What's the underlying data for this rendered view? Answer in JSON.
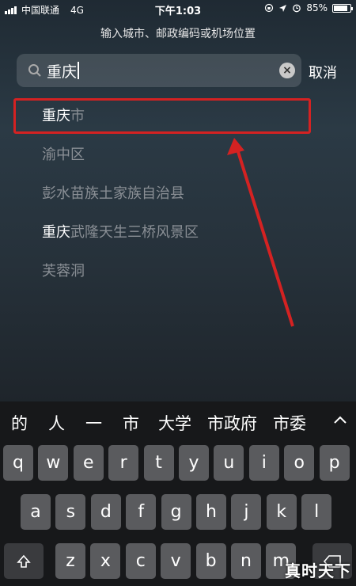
{
  "status_bar": {
    "carrier": "中国联通",
    "network": "4G",
    "time": "下午1:03",
    "battery": "85%",
    "battery_level": 0.85
  },
  "search": {
    "prompt": "输入城市、邮政编码或机场位置",
    "value": "重庆",
    "cancel_label": "取消"
  },
  "results": [
    {
      "match": "重庆",
      "rest": "市"
    },
    {
      "match": "",
      "rest": "渝中区"
    },
    {
      "match": "",
      "rest": "彭水苗族土家族自治县"
    },
    {
      "match": "重庆",
      "rest": "武隆天生三桥风景区"
    },
    {
      "match": "",
      "rest": "芙蓉洞"
    }
  ],
  "annotation_colors": {
    "box": "#d42222",
    "arrow": "#d42222"
  },
  "keyboard": {
    "candidates": [
      "的",
      "人",
      "一",
      "市",
      "大学",
      "市政府",
      "市委"
    ],
    "row1": [
      "q",
      "w",
      "e",
      "r",
      "t",
      "y",
      "u",
      "i",
      "o",
      "p"
    ],
    "row2": [
      "a",
      "s",
      "d",
      "f",
      "g",
      "h",
      "j",
      "k",
      "l"
    ],
    "row3": [
      "z",
      "x",
      "c",
      "v",
      "b",
      "n",
      "m"
    ]
  },
  "watermark": "真时天下",
  "icons": [
    "search-icon",
    "clear-icon",
    "chevron-up-icon",
    "shift-icon",
    "delete-icon",
    "signal-icon",
    "battery-icon",
    "alarm-icon",
    "location-icon",
    "lock-rotation-icon"
  ]
}
